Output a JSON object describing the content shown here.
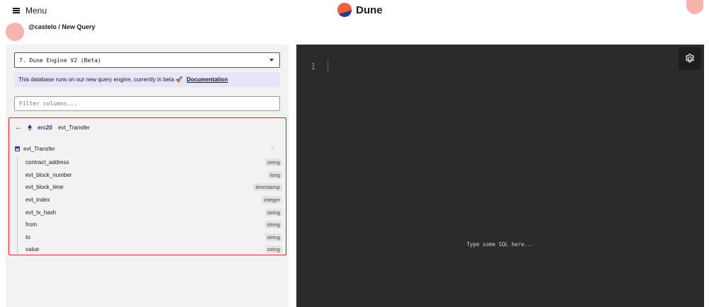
{
  "header": {
    "menu_label": "Menu",
    "logo_text": "Dune",
    "brand_colors": {
      "orange": "#f4603e",
      "navy": "#2d3a8c"
    }
  },
  "breadcrumb": "@castelo / New Query",
  "engine": {
    "selected": "7. Dune Engine V2 (Beta)"
  },
  "beta_notice": {
    "text": "This database runs on our new query engine, currently in beta 🚀",
    "link_label": "Documentation"
  },
  "filter": {
    "placeholder": "Filter columns..."
  },
  "schema": {
    "namespace": "erc20",
    "table": "evt_Transfer",
    "table_row_label": "evt_Transfer",
    "columns": [
      {
        "name": "contract_address",
        "type": "string"
      },
      {
        "name": "evt_block_number",
        "type": "long"
      },
      {
        "name": "evt_block_time",
        "type": "timestamp"
      },
      {
        "name": "evt_index",
        "type": "integer"
      },
      {
        "name": "evt_tx_hash",
        "type": "string"
      },
      {
        "name": "from",
        "type": "string"
      },
      {
        "name": "to",
        "type": "string"
      },
      {
        "name": "value",
        "type": "string"
      }
    ],
    "highlight_color": "#d9241c"
  },
  "editor": {
    "line_number": "1",
    "placeholder": "Type some SQL here...",
    "icon": "gear-icon"
  }
}
